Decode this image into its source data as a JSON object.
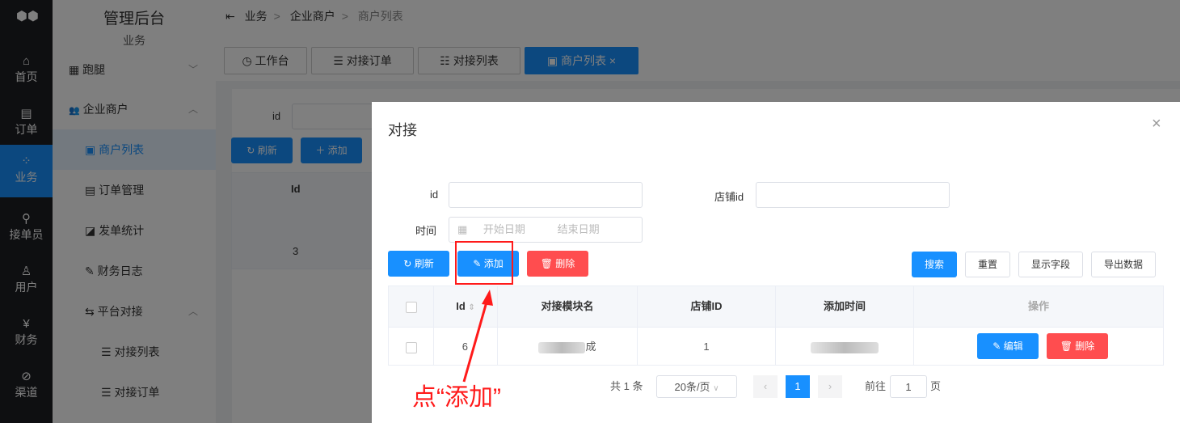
{
  "rail": {
    "items": [
      {
        "label": "首页",
        "icon": "home-icon",
        "glyph": "⌂"
      },
      {
        "label": "订单",
        "icon": "order-icon",
        "glyph": "▤"
      },
      {
        "label": "业务",
        "icon": "business-icon",
        "glyph": "⁘"
      },
      {
        "label": "接单员",
        "icon": "bike-icon",
        "glyph": "⚲"
      },
      {
        "label": "用户",
        "icon": "user-icon",
        "glyph": "♙"
      },
      {
        "label": "财务",
        "icon": "finance-icon",
        "glyph": "¥"
      },
      {
        "label": "渠道",
        "icon": "channel-icon",
        "glyph": "⊘"
      }
    ]
  },
  "sidebar": {
    "title": "管理后台",
    "subtitle": "业务",
    "items": [
      {
        "label": "跑腿",
        "glyph": "▦"
      },
      {
        "label": "企业商户",
        "glyph": "👥"
      },
      {
        "label": "商户列表",
        "glyph": "▣"
      },
      {
        "label": "订单管理",
        "glyph": "▤"
      },
      {
        "label": "发单统计",
        "glyph": "◪"
      },
      {
        "label": "财务日志",
        "glyph": "✎"
      },
      {
        "label": "平台对接",
        "glyph": "⇆"
      },
      {
        "label": "对接列表",
        "glyph": "☰"
      },
      {
        "label": "对接订单",
        "glyph": "☰"
      }
    ]
  },
  "breadcrumb": [
    "业务",
    "企业商户",
    "商户列表"
  ],
  "tabs": [
    "工作台",
    "对接订单",
    "对接列表",
    "商户列表"
  ],
  "bg": {
    "id_label": "id",
    "refresh": "刷新",
    "add": "添加",
    "col_id": "Id",
    "row_id": "3"
  },
  "modal": {
    "title": "对接",
    "close": "×",
    "form": {
      "id_label": "id",
      "shop_label": "店铺id",
      "time_label": "时间",
      "start_placeholder": "开始日期",
      "end_placeholder": "结束日期"
    },
    "buttons": {
      "refresh": "刷新",
      "add": "添加",
      "delete": "删除",
      "search": "搜索",
      "reset": "重置",
      "fields": "显示字段",
      "export": "导出数据"
    },
    "table": {
      "headers": [
        "Id",
        "对接模块名",
        "店铺ID",
        "添加时间",
        "操作"
      ],
      "row": {
        "id": "6",
        "name_suffix": "成",
        "shop_id": "1",
        "edit": "编辑",
        "delete": "删除"
      }
    },
    "pagination": {
      "total": "共 1 条",
      "page_size": "20条/页",
      "current": "1",
      "goto_label": "前往",
      "goto_value": "1",
      "page_suffix": "页"
    }
  },
  "annotation": {
    "text": "点“添加”",
    "color": "#ff1a1a"
  }
}
